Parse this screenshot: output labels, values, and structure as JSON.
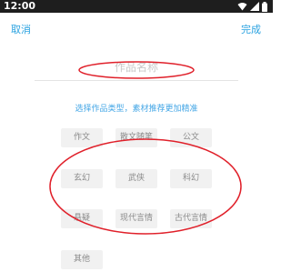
{
  "status_bar": {
    "time": "12:00",
    "icons": [
      "wifi-icon",
      "signal-icon",
      "battery-icon"
    ]
  },
  "nav": {
    "cancel_label": "取消",
    "done_label": "完成"
  },
  "title_field": {
    "placeholder": "作品名称",
    "value": ""
  },
  "hint_text": "选择作品类型，素材推荐更加精准",
  "categories": [
    {
      "label": "作文"
    },
    {
      "label": "散文随笔"
    },
    {
      "label": "公文"
    },
    {
      "label": "玄幻"
    },
    {
      "label": "武侠"
    },
    {
      "label": "科幻"
    },
    {
      "label": "悬疑"
    },
    {
      "label": "现代言情"
    },
    {
      "label": "古代言情"
    },
    {
      "label": "其他"
    }
  ],
  "colors": {
    "accent": "#2aa2e0",
    "chip_bg": "#f1f1f1",
    "chip_text": "#8a8a8a",
    "annotation": "#e0202a"
  }
}
